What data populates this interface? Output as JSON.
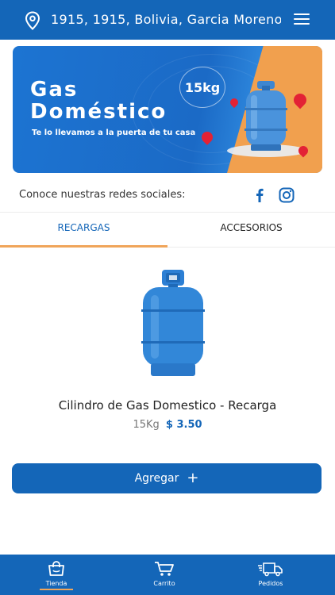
{
  "header": {
    "address": "1915, 1915, Bolivia, Garcia Moreno...",
    "location_icon": "map-pin-icon",
    "menu_icon": "hamburger-menu-icon"
  },
  "banner": {
    "title_line1": "Gas",
    "title_line2": "Doméstico",
    "tagline": "Te lo llevamos a la puerta de tu casa",
    "badge": "15kg",
    "colors": {
      "blue": "#1b6ac6",
      "orange": "#f1a04e",
      "marker": "#e32235"
    }
  },
  "social": {
    "label": "Conoce nuestras redes sociales:",
    "icons": [
      "facebook-icon",
      "instagram-icon"
    ]
  },
  "tabs": [
    {
      "label": "RECARGAS",
      "active": true
    },
    {
      "label": "ACCESORIOS",
      "active": false
    }
  ],
  "product": {
    "name": "Cilindro de Gas Domestico - Recarga",
    "weight": "15Kg",
    "price": "$ 3.50"
  },
  "actions": {
    "add_label": "Agregar",
    "add_icon": "+"
  },
  "bottom_nav": [
    {
      "label": "Tienda",
      "icon": "shopping-bag-icon",
      "active": true
    },
    {
      "label": "Carrito",
      "icon": "cart-icon",
      "active": false
    },
    {
      "label": "Pedidos",
      "icon": "delivery-truck-icon",
      "active": false
    }
  ],
  "theme": {
    "primary": "#1466b8",
    "accent": "#f0a55a"
  }
}
